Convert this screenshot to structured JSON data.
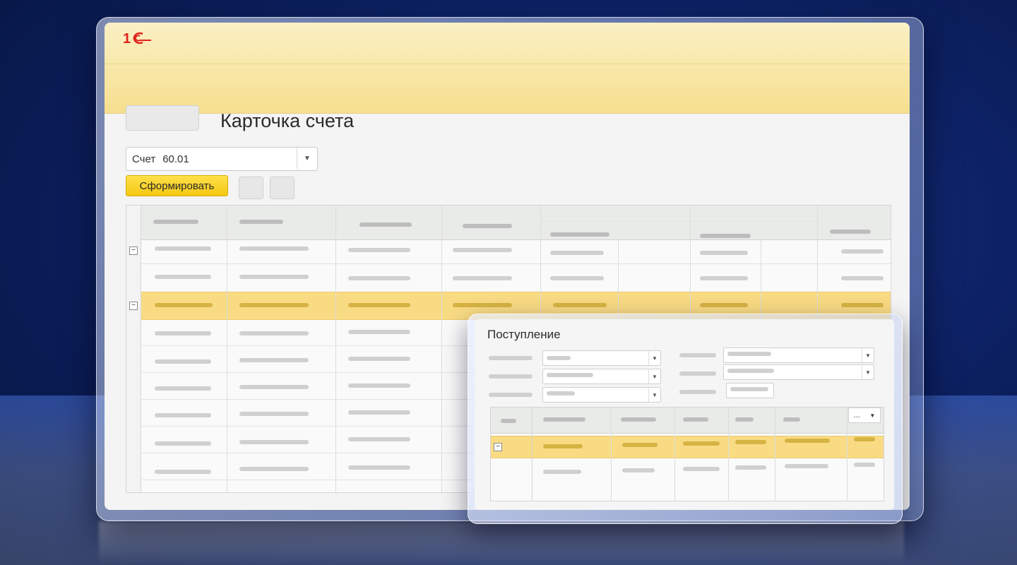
{
  "app": {
    "logo_text": "1С",
    "brand_color": "#e0241c"
  },
  "main_window": {
    "title": "Карточка счета",
    "account_select": {
      "label": "Счет",
      "value": "60.01",
      "dropdown_icon": "chevron-down-icon"
    },
    "generate_button": "Сформировать",
    "accent_color": "#f5c518",
    "highlight_row_color": "#f9db84"
  },
  "sub_window": {
    "title": "Поступление",
    "more_button": {
      "label": "...",
      "dropdown_icon": "chevron-down-icon"
    }
  }
}
